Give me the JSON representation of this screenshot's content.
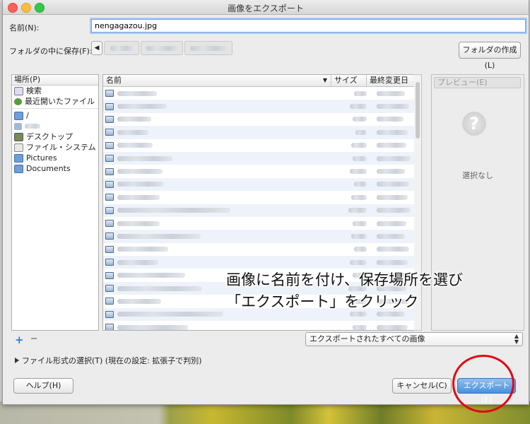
{
  "window": {
    "title": "画像をエクスポート"
  },
  "name_field": {
    "label": "名前(N):",
    "value": "nengagazou.jpg"
  },
  "folder": {
    "label": "フォルダの中に保存(F):",
    "create_button": "フォルダの作成(L)"
  },
  "places": {
    "header": "場所(P)",
    "items": [
      {
        "label": "検索",
        "icon": "search-icon"
      },
      {
        "label": "最近開いたファイル",
        "icon": "recent-icon"
      },
      {
        "label": "/",
        "icon": "folder-icon"
      },
      {
        "label": "",
        "icon": "home-folder-icon"
      },
      {
        "label": "デスクトップ",
        "icon": "desktop-icon"
      },
      {
        "label": "ファイル・システム",
        "icon": "drive-icon"
      },
      {
        "label": "Pictures",
        "icon": "folder-icon"
      },
      {
        "label": "Documents",
        "icon": "folder-icon"
      }
    ]
  },
  "files": {
    "columns": {
      "name": "名前",
      "size": "サイズ",
      "modified": "最終変更日"
    }
  },
  "preview": {
    "button": "プレビュー(E)",
    "empty": "選択なし"
  },
  "filter": {
    "value": "エクスポートされたすべての画像"
  },
  "filetype": {
    "label": "ファイル形式の選択(T) (現在の設定: 拡張子で判別)"
  },
  "buttons": {
    "help": "ヘルプ(H)",
    "cancel": "キャンセル(C)",
    "export": "エクスポート(E)"
  },
  "annotation": {
    "line1": "画像に名前を付け、保存場所を選び",
    "line2": "「エクスポート」をクリック"
  },
  "colors": {
    "annotation_circle": "#e30613",
    "accent": "#4a8fdc"
  }
}
